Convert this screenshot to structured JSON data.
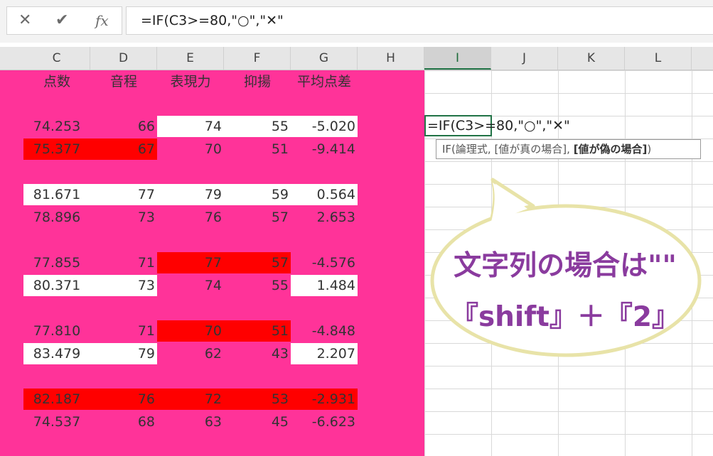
{
  "formula_bar": {
    "cancel_icon": "close-icon",
    "enter_icon": "check-icon",
    "fx_label": "fx",
    "formula": "=IF(C3>=80,\"○\",\"✕\""
  },
  "columns": [
    "C",
    "D",
    "E",
    "F",
    "G",
    "H",
    "I",
    "J",
    "K",
    "L"
  ],
  "selected_column": "I",
  "headers": {
    "c": "点数",
    "d": "音程",
    "e": "表現力",
    "f": "抑揚",
    "g": "平均点差"
  },
  "rows": [
    {
      "c": "74.253",
      "d": "66",
      "e": "74",
      "f": "55",
      "g": "-5.020"
    },
    {
      "c": "75.377",
      "d": "67",
      "e": "70",
      "f": "51",
      "g": "-9.414"
    },
    {
      "c": "81.671",
      "d": "77",
      "e": "79",
      "f": "59",
      "g": "0.564"
    },
    {
      "c": "78.896",
      "d": "73",
      "e": "76",
      "f": "57",
      "g": "2.653"
    },
    {
      "c": "77.855",
      "d": "71",
      "e": "77",
      "f": "57",
      "g": "-4.576"
    },
    {
      "c": "80.371",
      "d": "73",
      "e": "74",
      "f": "55",
      "g": "1.484"
    },
    {
      "c": "77.810",
      "d": "71",
      "e": "70",
      "f": "51",
      "g": "-4.848"
    },
    {
      "c": "83.479",
      "d": "79",
      "e": "62",
      "f": "43",
      "g": "2.207"
    },
    {
      "c": "82.187",
      "d": "76",
      "e": "72",
      "f": "53",
      "g": "-2.931"
    },
    {
      "c": "74.537",
      "d": "68",
      "e": "63",
      "f": "45",
      "g": "-6.623"
    }
  ],
  "editing_cell": {
    "text": "=IF(C3>=80,\"○\",\"✕\""
  },
  "tooltip": {
    "prefix": "IF(論理式, [値が真の場合], ",
    "bold": "[値が偽の場合]",
    "suffix": ")"
  },
  "callout": {
    "line1": "文字列の場合は\"\"",
    "line2": "『shift』＋『2』"
  },
  "colors": {
    "pink": "#ff3399",
    "red": "#ff0000",
    "excel_green": "#217346",
    "callout_border": "#e8e3a8",
    "callout_text": "#8a3b9e"
  }
}
